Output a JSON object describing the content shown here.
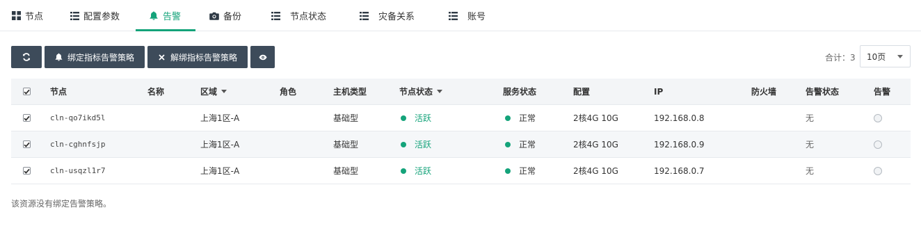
{
  "tabs": [
    {
      "label": "节点",
      "icon": "grid-icon"
    },
    {
      "label": "配置参数",
      "icon": "list-icon"
    },
    {
      "label": "告警",
      "icon": "bell-icon"
    },
    {
      "label": "备份",
      "icon": "camera-icon"
    },
    {
      "label": "节点状态",
      "icon": "list-icon"
    },
    {
      "label": "灾备关系",
      "icon": "list-icon"
    },
    {
      "label": "账号",
      "icon": "list-icon"
    }
  ],
  "active_tab": "告警",
  "colors": {
    "accent": "#14a37a",
    "button_bg": "#3d4b5a"
  },
  "toolbar": {
    "refresh_icon": "refresh-icon",
    "bind_label": "绑定指标告警策略",
    "unbind_label": "解绑指标告警策略",
    "view_icon": "eye-icon"
  },
  "pagination": {
    "total_label": "合计：3",
    "page_size": "10页"
  },
  "table": {
    "headers": {
      "node": "节点",
      "name": "名称",
      "zone": "区域",
      "role": "角色",
      "host_type": "主机类型",
      "node_status": "节点状态",
      "service_status": "服务状态",
      "config": "配置",
      "ip": "IP",
      "firewall": "防火墙",
      "alert_status": "告警状态",
      "alert": "告警"
    },
    "rows": [
      {
        "node": "cln-qo7ikd5l",
        "name": "",
        "zone": "上海1区-A",
        "role": "",
        "host_type": "基础型",
        "node_status": "活跃",
        "service_status": "正常",
        "config": "2核4G 10G",
        "ip": "192.168.0.8",
        "firewall": "",
        "alert_status": "无",
        "checked": true
      },
      {
        "node": "cln-cghnfsjp",
        "name": "",
        "zone": "上海1区-A",
        "role": "",
        "host_type": "基础型",
        "node_status": "活跃",
        "service_status": "正常",
        "config": "2核4G 10G",
        "ip": "192.168.0.9",
        "firewall": "",
        "alert_status": "无",
        "checked": true
      },
      {
        "node": "cln-usqzl1r7",
        "name": "",
        "zone": "上海1区-A",
        "role": "",
        "host_type": "基础型",
        "node_status": "活跃",
        "service_status": "正常",
        "config": "2核4G 10G",
        "ip": "192.168.0.7",
        "firewall": "",
        "alert_status": "无",
        "checked": true
      }
    ]
  },
  "footer_note": "该资源没有绑定告警策略。"
}
